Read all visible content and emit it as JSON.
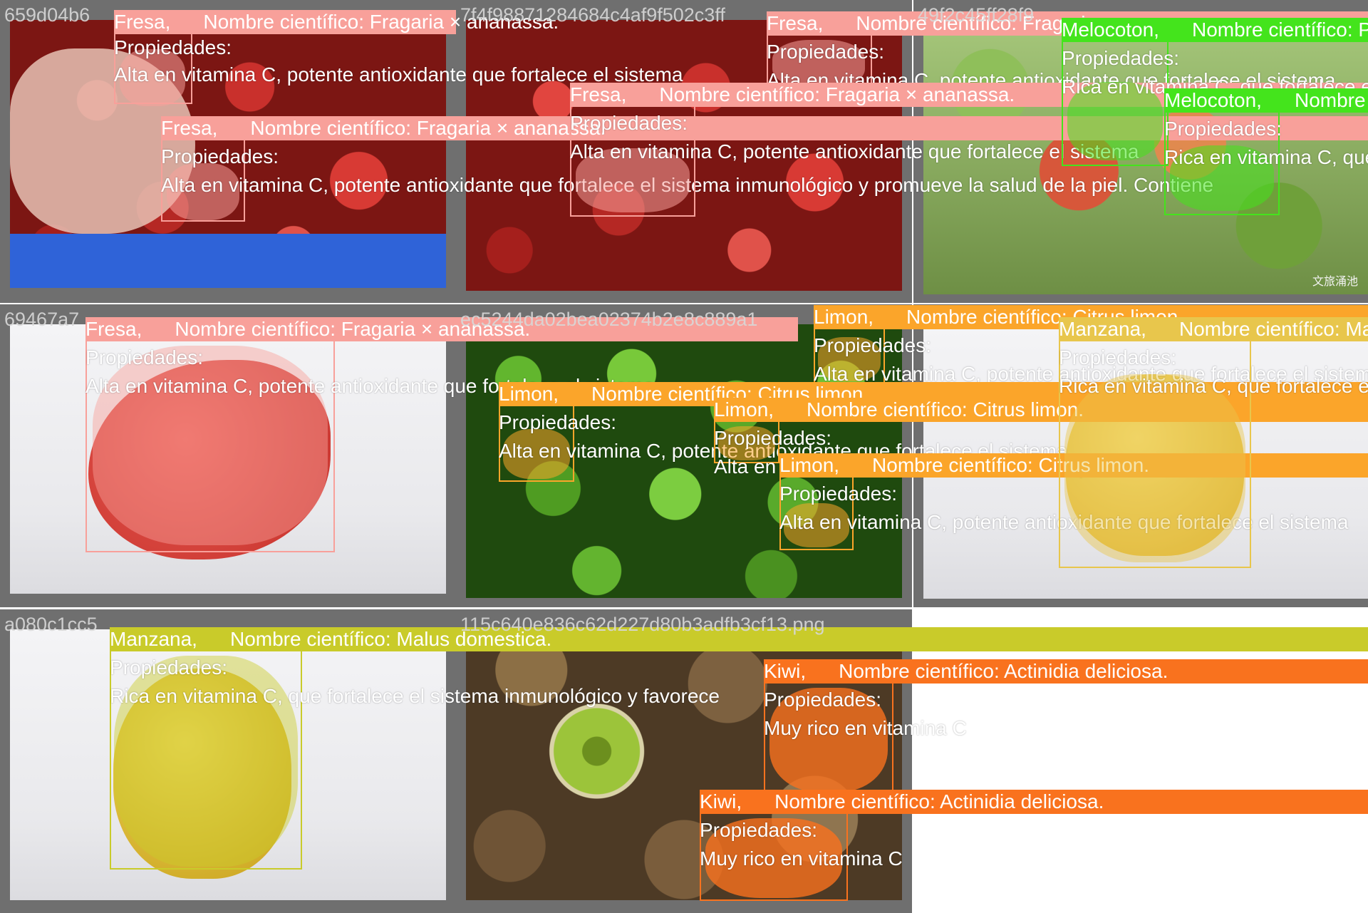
{
  "page": {
    "cell_titles": [
      "659d04b6",
      "7f4f98871284684c4af9f502c3ff",
      "49f2c45ff28f9",
      "69467a7",
      "ec5244da02bea02374b2e8c889a1",
      "",
      "a080c1cc5",
      "115c640e836c62d227d80b3adfb3cf13.png"
    ],
    "watermark": "文旅涌池"
  },
  "colors": {
    "fresa": "#f8a09a",
    "melocoton": "#44e41c",
    "limon": "#fba52a",
    "manzana_right": "#e8c64c",
    "manzana_left": "#c9cb2a",
    "kiwi": "#f9721e"
  },
  "labels": {
    "fresa": {
      "name": "Fresa,",
      "sci": "Nombre científico: Fragaria × ananassa.",
      "prop": "Propiedades:",
      "desc": "Alta en vitamina C, potente antioxidante que fortalece el sistema inmunológico y promueve la salud de la piel. Contiene"
    },
    "fresa_short": {
      "desc": "Alta en vitamina C, potente antioxidante que fortalece el sistema"
    },
    "melocoton": {
      "name": "Melocoton,",
      "sci": "Nombre científico: Prunus persica.",
      "prop": "Propiedades:",
      "desc": "Rica en vitamina C, que fortalece el sistema inmunológico"
    },
    "limon": {
      "name": "Limon,",
      "sci": "Nombre científico: Citrus limon.",
      "prop": "Propiedades:",
      "desc": "Alta en vitamina C, potente antioxidante que fortalece el sistema"
    },
    "manzana": {
      "name": "Manzana,",
      "sci": "Nombre científico: Malus domestica.",
      "prop": "Propiedades:",
      "desc": "Rica en vitamina C, que fortalece el sistema inmunológico y favorece"
    },
    "kiwi": {
      "name": "Kiwi,",
      "sci": "Nombre científico: Actinidia deliciosa.",
      "prop": "Propiedades:",
      "desc": "Muy rico en vitamina C"
    }
  }
}
